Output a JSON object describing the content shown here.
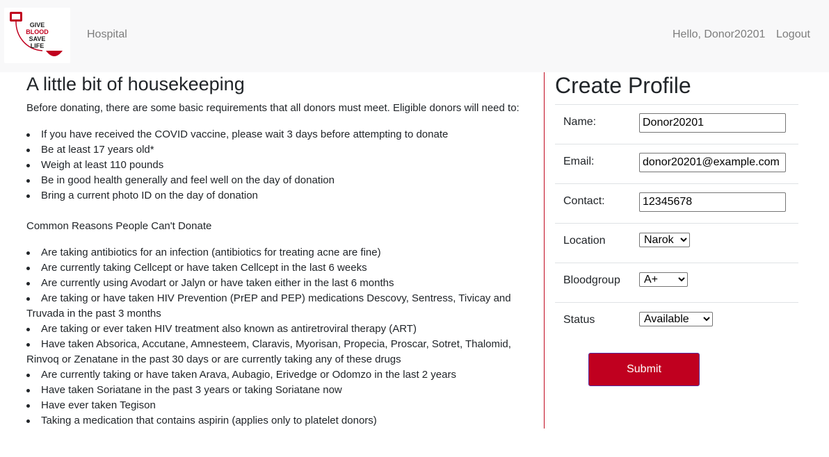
{
  "nav": {
    "logo_lines": [
      "GIVE",
      "BLOOD",
      "SAVE",
      "LIFE"
    ],
    "hospital_link": "Hospital",
    "greeting": "Hello, Donor20201",
    "logout": "Logout"
  },
  "housekeeping": {
    "title": "A little bit of housekeeping",
    "intro": "Before donating, there are some basic requirements that all donors must meet. Eligible donors will need to:",
    "requirements": [
      "If you have received the COVID vaccine, please wait 3 days before attempting to donate",
      "Be at least 17 years old*",
      "Weigh at least 110 pounds",
      "Be in good health generally and feel well on the day of donation",
      "Bring a current photo ID on the day of donation"
    ],
    "common_title": "Common Reasons People Can't Donate",
    "reasons": [
      "Are taking antibiotics for an infection (antibiotics for treating acne are fine)",
      "Are currently taking Cellcept or have taken Cellcept in the last 6 weeks",
      "Are currently using Avodart or Jalyn or have taken either in the last 6 months",
      "Are taking or have taken HIV Prevention (PrEP and PEP) medications Descovy, Sentress, Tivicay and Truvada in the past 3 months",
      "Are taking or ever taken HIV treatment also known as antiretroviral therapy (ART)",
      "Have taken Absorica, Accutane, Amnesteem, Claravis, Myorisan, Propecia, Proscar, Sotret, Thalomid, Rinvoq or Zenatane in the past 30 days or are currently taking any of these drugs",
      "Are currently taking or have taken Arava, Aubagio, Erivedge or Odomzo in the last 2 years",
      "Have taken Soriatane in the past 3 years or taking Soriatane now",
      "Have ever taken Tegison",
      "Taking a medication that contains aspirin (applies only to platelet donors)"
    ]
  },
  "profile": {
    "title": "Create Profile",
    "name_label": "Name:",
    "name_value": "Donor20201",
    "email_label": "Email:",
    "email_value": "donor20201@example.com",
    "contact_label": "Contact:",
    "contact_value": "12345678",
    "location_label": "Location",
    "location_value": "Narok",
    "bloodgroup_label": "Bloodgroup",
    "bloodgroup_value": "A+",
    "status_label": "Status",
    "status_value": "Available",
    "submit_label": "Submit"
  },
  "colors": {
    "accent_red": "#c0001f",
    "divider_red": "#c0091e",
    "navbar_bg": "#f8f8f9"
  }
}
